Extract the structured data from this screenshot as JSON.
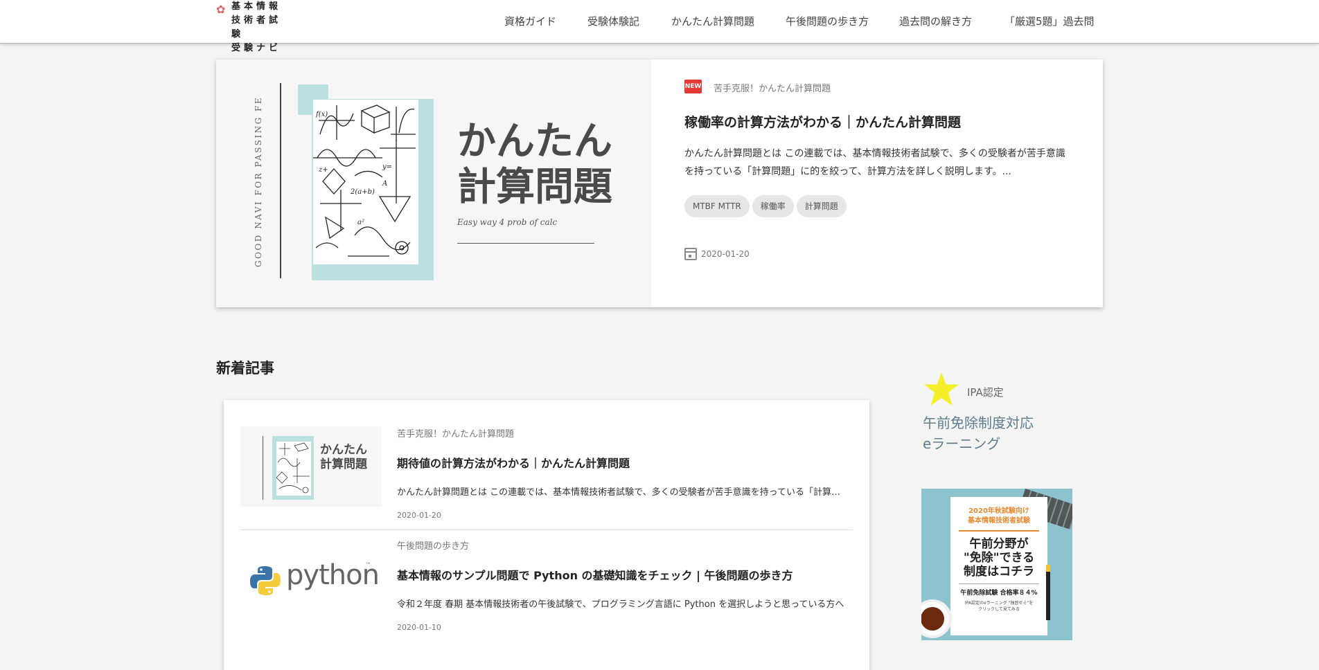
{
  "header": {
    "logo_lines": [
      "基本情報",
      "技術者試験",
      "受験ナビ"
    ],
    "nav": [
      {
        "label": "資格ガイド"
      },
      {
        "label": "受験体験記"
      },
      {
        "label": "かんたん計算問題"
      },
      {
        "label": "午後問題の歩き方"
      },
      {
        "label": "過去問の解き方"
      },
      {
        "label": "「厳選5題」過去問"
      }
    ]
  },
  "hero": {
    "thumb": {
      "vertical_text": "GOOD NAVI FOR PASSING FE",
      "title_line1": "かんたん",
      "title_line2": "計算問題",
      "subtitle": "Easy way 4 prob of calc"
    },
    "badge": "NEW",
    "category": "苦手克服！かんたん計算問題",
    "title": "稼働率の計算方法がわかる｜かんたん計算問題",
    "excerpt": "かんたん計算問題とは この連載では、基本情報技術者試験で、多くの受験者が苦手意識を持っている「計算問題」に的を絞って、計算方法を詳しく説明します。...",
    "tags": [
      "MTBF MTTR",
      "稼働率",
      "計算問題"
    ],
    "date": "2020-01-20"
  },
  "new_articles": {
    "heading": "新着記事",
    "items": [
      {
        "thumb_title_line1": "かんたん",
        "thumb_title_line2": "計算問題",
        "category": "苦手克服！かんたん計算問題",
        "title": "期待値の計算方法がわかる｜かんたん計算問題",
        "excerpt": "かんたん計算問題とは この連載では、基本情報技術者試験で、多くの受験者が苦手意識を持っている「計算問題」に的を絞って、計算方法を詳しく説明します。",
        "date": "2020-01-20"
      },
      {
        "thumb_word": "python",
        "thumb_tm": "™",
        "category": "午後問題の歩き方",
        "title": "基本情報のサンプル問題で Python の基礎知識をチェック | 午後問題の歩き方",
        "excerpt": "令和２年度 春期 基本情報技術者の午後試験で、プログラミング言語に Python を選択しようと思っている方へ",
        "date": "2020-01-10"
      }
    ]
  },
  "sidebar": {
    "badge_label": "IPA認定",
    "heading_line1": "午前免除制度対応",
    "heading_line2": "eラーニング",
    "ad": {
      "top_line1": "2020年秋試験向け",
      "top_line2": "基本情報技術者試験",
      "main_line1": "午前分野が",
      "main_line2": "\"免除\"できる",
      "main_line3": "制度はコチラ",
      "rate": "午前免除試験 合格率８４%",
      "small_line1": "IPA認定のeラーニング \"独習ゼミ\"を",
      "small_line2": "クリックして見てみる"
    }
  },
  "colors": {
    "accent_teal": "#bcdfe0",
    "badge_red": "#e53935",
    "star_yellow": "#f5ef2a",
    "sidebar_heading": "#5d7c8c"
  }
}
